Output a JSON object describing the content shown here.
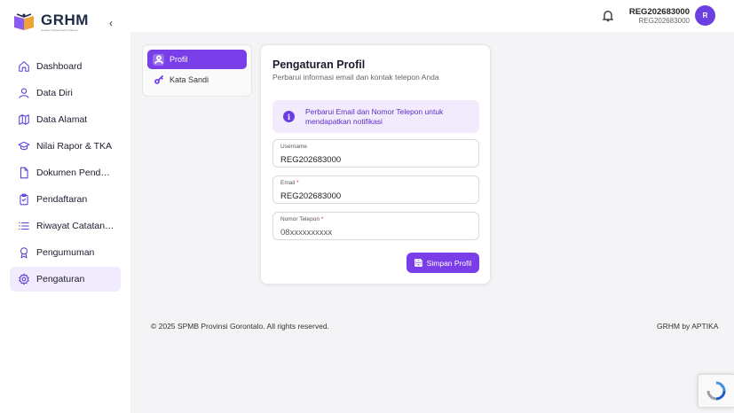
{
  "brand": {
    "name": "GRHM",
    "tagline": "Gerakan Rakyat Hebat Makmur"
  },
  "sidebar": {
    "items": [
      {
        "label": "Dashboard",
        "icon": "home-icon"
      },
      {
        "label": "Data Diri",
        "icon": "user-icon"
      },
      {
        "label": "Data Alamat",
        "icon": "map-icon"
      },
      {
        "label": "Nilai Rapor & TKA",
        "icon": "graduation-cap-icon"
      },
      {
        "label": "Dokumen Pendaftaran",
        "icon": "file-icon"
      },
      {
        "label": "Pendaftaran",
        "icon": "clipboard-check-icon"
      },
      {
        "label": "Riwayat Catatan Daftar",
        "icon": "list-icon"
      },
      {
        "label": "Pengumuman",
        "icon": "award-icon"
      },
      {
        "label": "Pengaturan",
        "icon": "gear-icon",
        "active": true
      }
    ]
  },
  "topbar": {
    "user_name": "REG202683000",
    "user_sub": "REG202683000",
    "avatar_initial": "R"
  },
  "settings_nav": {
    "items": [
      {
        "label": "Profil",
        "icon": "user-icon",
        "active": true
      },
      {
        "label": "Kata Sandi",
        "icon": "key-icon"
      }
    ]
  },
  "profile": {
    "title": "Pengaturan Profil",
    "subtitle": "Perbarui informasi email dan kontak telepon Anda",
    "alert": "Perbarui Email dan Nomor Telepon untuk mendapatkan notifikasi",
    "username": {
      "label": "Username",
      "value": "REG202683000"
    },
    "email": {
      "label": "Email",
      "required_mark": "*",
      "value": "REG202683000"
    },
    "phone": {
      "label": "Nomor Telepon",
      "required_mark": "*",
      "placeholder": "08xxxxxxxxxx"
    },
    "save_label": "Simpan Profil"
  },
  "footer": {
    "copyright": "© 2025 SPMB Provinsi Gorontalo. All rights reserved.",
    "credit": "GRHM by APTIKA"
  },
  "colors": {
    "accent": "#7a3ee8",
    "accent_light": "#f1ebfd",
    "icon": "#5b3fd6"
  }
}
